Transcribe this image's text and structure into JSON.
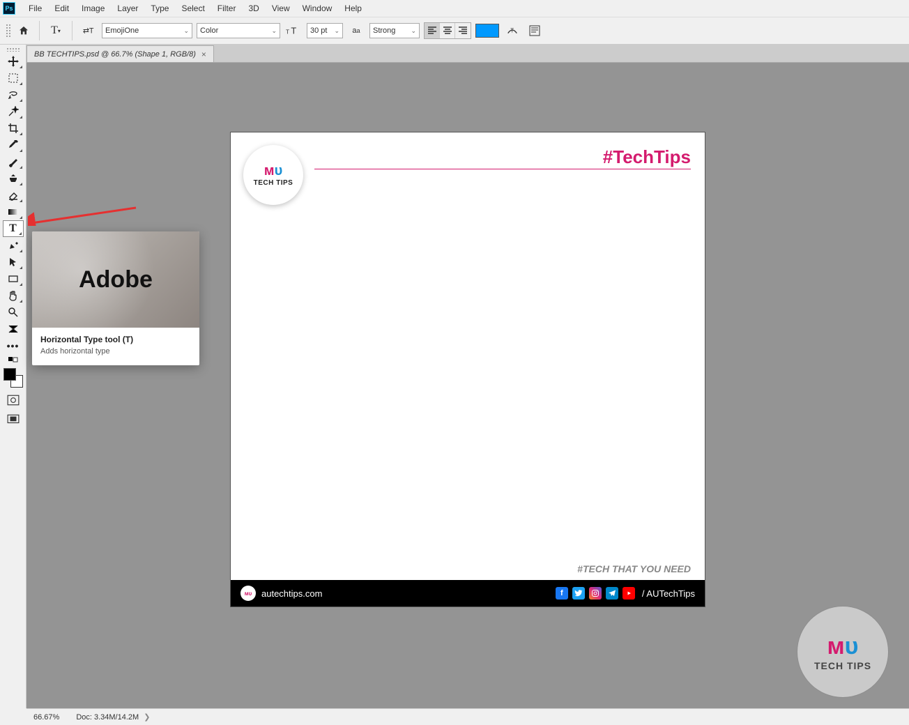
{
  "menu": [
    "File",
    "Edit",
    "Image",
    "Layer",
    "Type",
    "Select",
    "Filter",
    "3D",
    "View",
    "Window",
    "Help"
  ],
  "options": {
    "font_family": "EmojiOne",
    "font_style": "Color",
    "font_size": "30 pt",
    "anti_alias": "Strong",
    "color_swatch": "#0099ff"
  },
  "tab": {
    "title": "BB TECHTIPS.psd @ 66.7% (Shape 1, RGB/8)"
  },
  "tooltip": {
    "brand": "Adobe",
    "title": "Horizontal Type tool (T)",
    "description": "Adds horizontal type"
  },
  "canvas": {
    "hashtag": "#TechTips",
    "logo_sub": "TECH TIPS",
    "tagline": "#TECH THAT YOU NEED",
    "footer_url": "autechtips.com",
    "footer_handle": "/ AUTechTips"
  },
  "watermark": {
    "sub": "TECH TIPS"
  },
  "status": {
    "zoom": "66.67%",
    "doc": "Doc: 3.34M/14.2M"
  }
}
